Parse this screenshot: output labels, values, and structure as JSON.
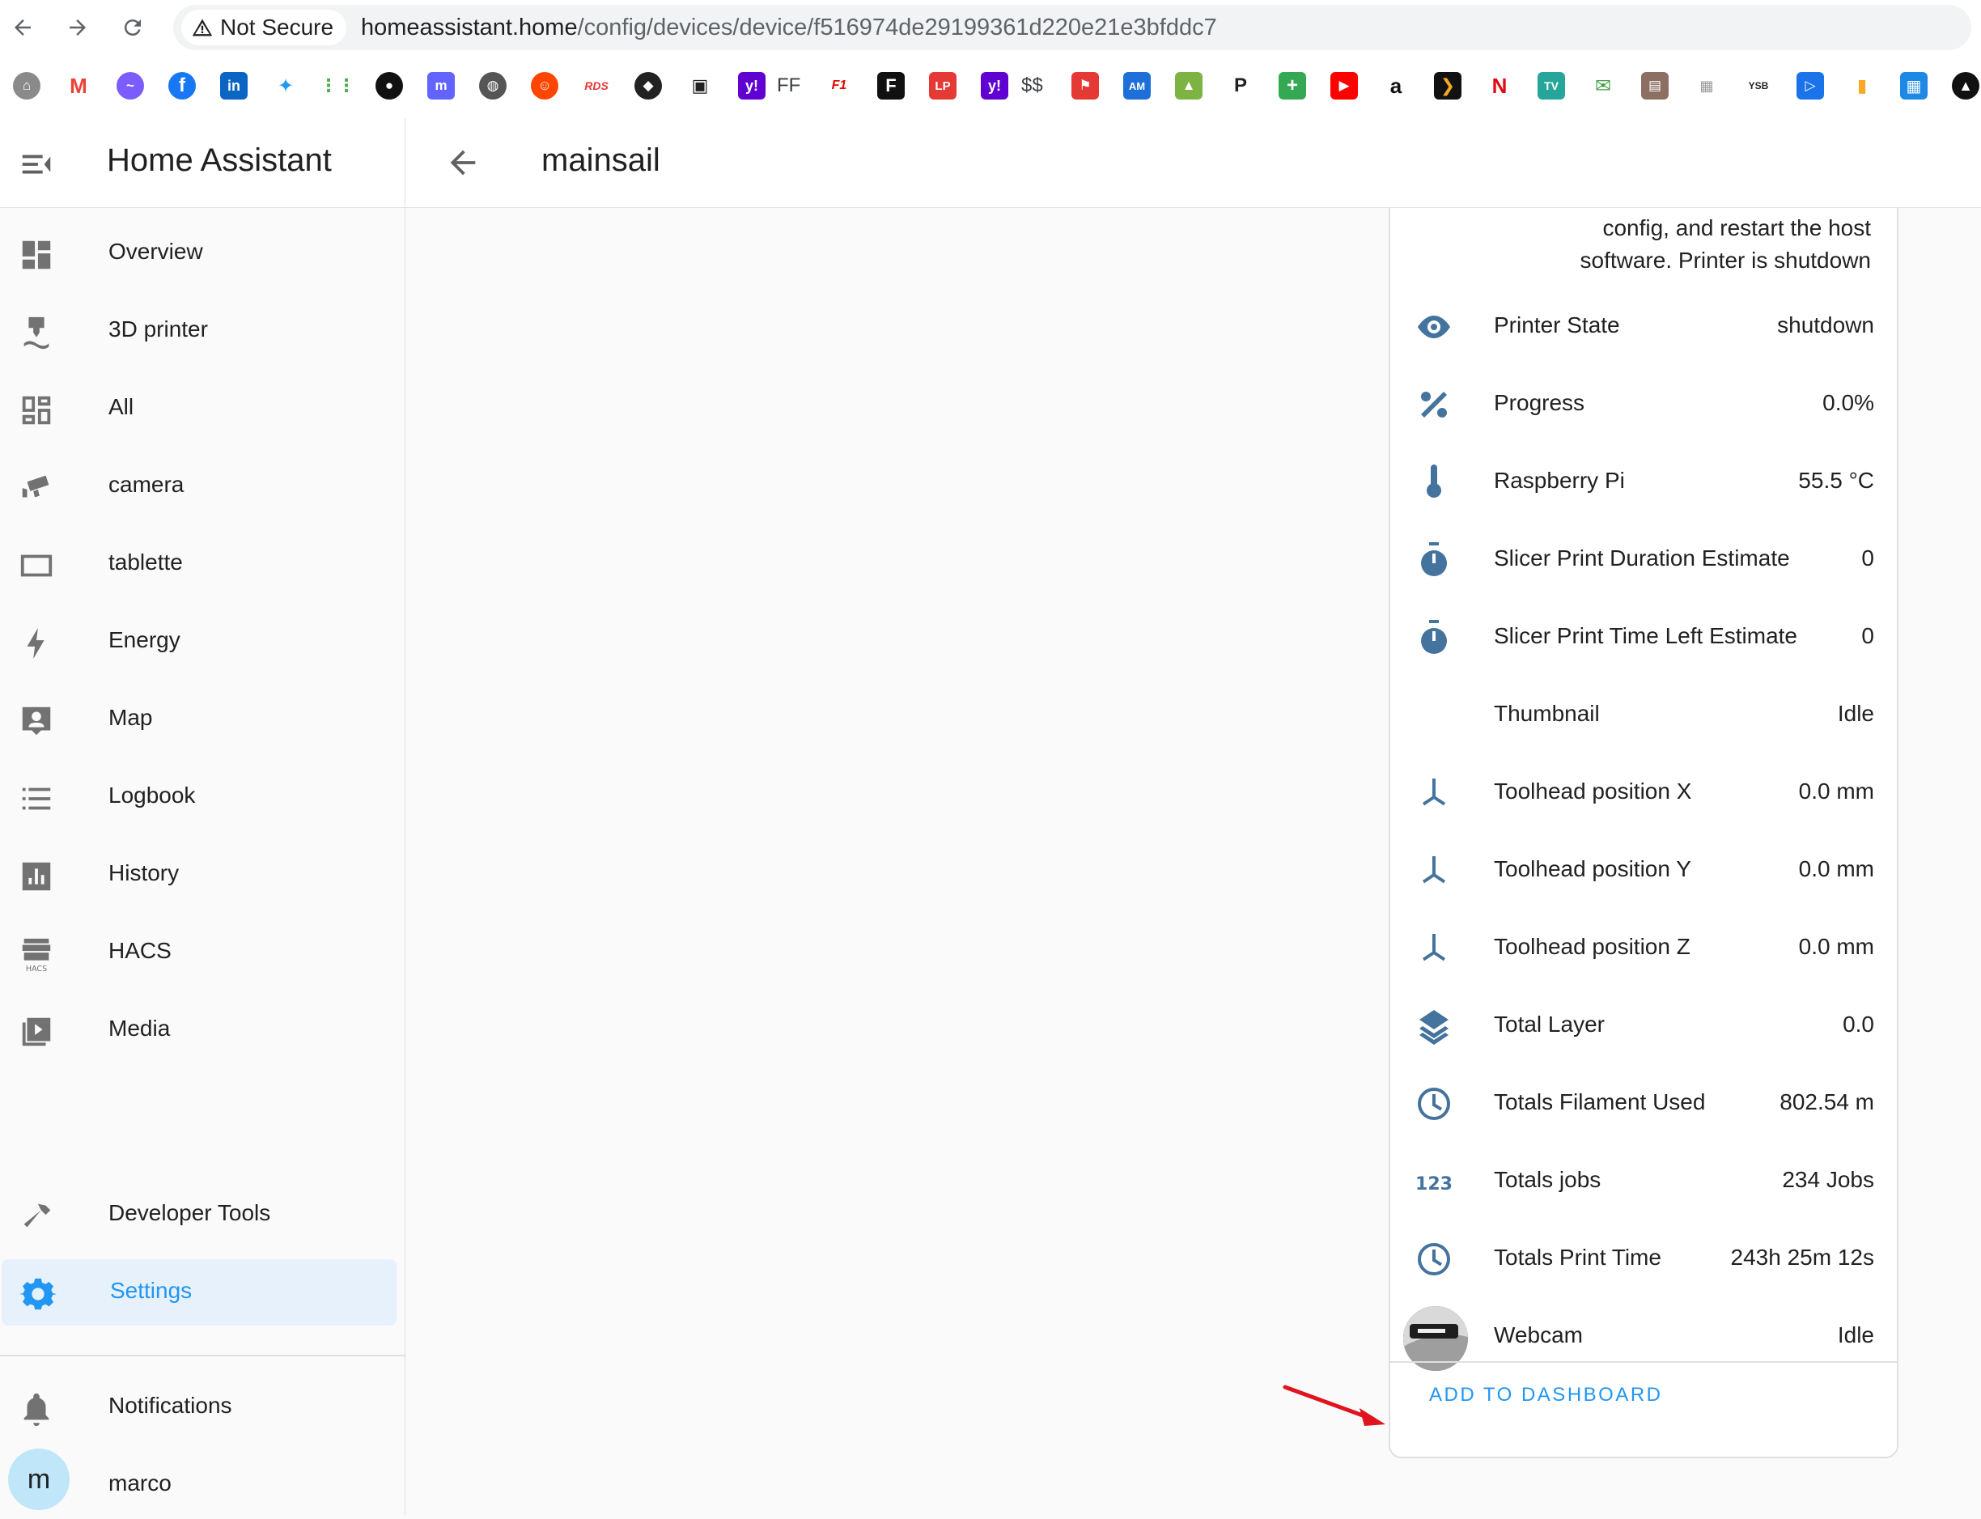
{
  "browser": {
    "security_label": "Not Secure",
    "url_host": "homeassistant.home",
    "url_path": "/config/devices/device/f516974de29199361d220e21e3bfddc7",
    "bookmark_ff": "FF",
    "bookmark_money": "$$"
  },
  "sidebar": {
    "title": "Home Assistant",
    "items": [
      {
        "label": "Overview"
      },
      {
        "label": "3D printer"
      },
      {
        "label": "All"
      },
      {
        "label": "camera"
      },
      {
        "label": "tablette"
      },
      {
        "label": "Energy"
      },
      {
        "label": "Map"
      },
      {
        "label": "Logbook"
      },
      {
        "label": "History"
      },
      {
        "label": "HACS"
      },
      {
        "label": "Media"
      },
      {
        "label": "Developer Tools"
      },
      {
        "label": "Settings"
      },
      {
        "label": "Notifications"
      }
    ],
    "user": {
      "initial": "m",
      "name": "marco"
    },
    "hacs_icon_text": "HACS"
  },
  "header": {
    "title": "mainsail"
  },
  "card": {
    "notice_line1": "config, and restart the host",
    "notice_line2": "software. Printer is shutdown",
    "rows": [
      {
        "name": "Printer State",
        "value": "shutdown",
        "icon": "eye-icon"
      },
      {
        "name": "Progress",
        "value": "0.0%",
        "icon": "percent-icon"
      },
      {
        "name": "Raspberry Pi",
        "value": "55.5 °C",
        "icon": "thermometer-icon"
      },
      {
        "name": "Slicer Print Duration Estimate",
        "value": "0",
        "icon": "timer-icon"
      },
      {
        "name": "Slicer Print Time Left Estimate",
        "value": "0",
        "icon": "timer-icon"
      },
      {
        "name": "Thumbnail",
        "value": "Idle",
        "icon": ""
      },
      {
        "name": "Toolhead position X",
        "value": "0.0 mm",
        "icon": "axis-icon"
      },
      {
        "name": "Toolhead position Y",
        "value": "0.0 mm",
        "icon": "axis-icon"
      },
      {
        "name": "Toolhead position Z",
        "value": "0.0 mm",
        "icon": "axis-icon"
      },
      {
        "name": "Total Layer",
        "value": "0.0",
        "icon": "layers-icon"
      },
      {
        "name": "Totals Filament Used",
        "value": "802.54 m",
        "icon": "clock-icon"
      },
      {
        "name": "Totals jobs",
        "value": "234 Jobs",
        "icon": "numeric-icon"
      },
      {
        "name": "Totals Print Time",
        "value": "243h 25m 12s",
        "icon": "clock-icon"
      },
      {
        "name": "Webcam",
        "value": "Idle",
        "icon": "webcam-thumbnail"
      }
    ],
    "numeric_icon_text": "123",
    "add_button": "ADD TO DASHBOARD"
  },
  "colors": {
    "accent": "#2196f3",
    "entity_icon": "#44739e",
    "active_bg": "#e7f1fb",
    "annotation_arrow": "#e0141e"
  }
}
